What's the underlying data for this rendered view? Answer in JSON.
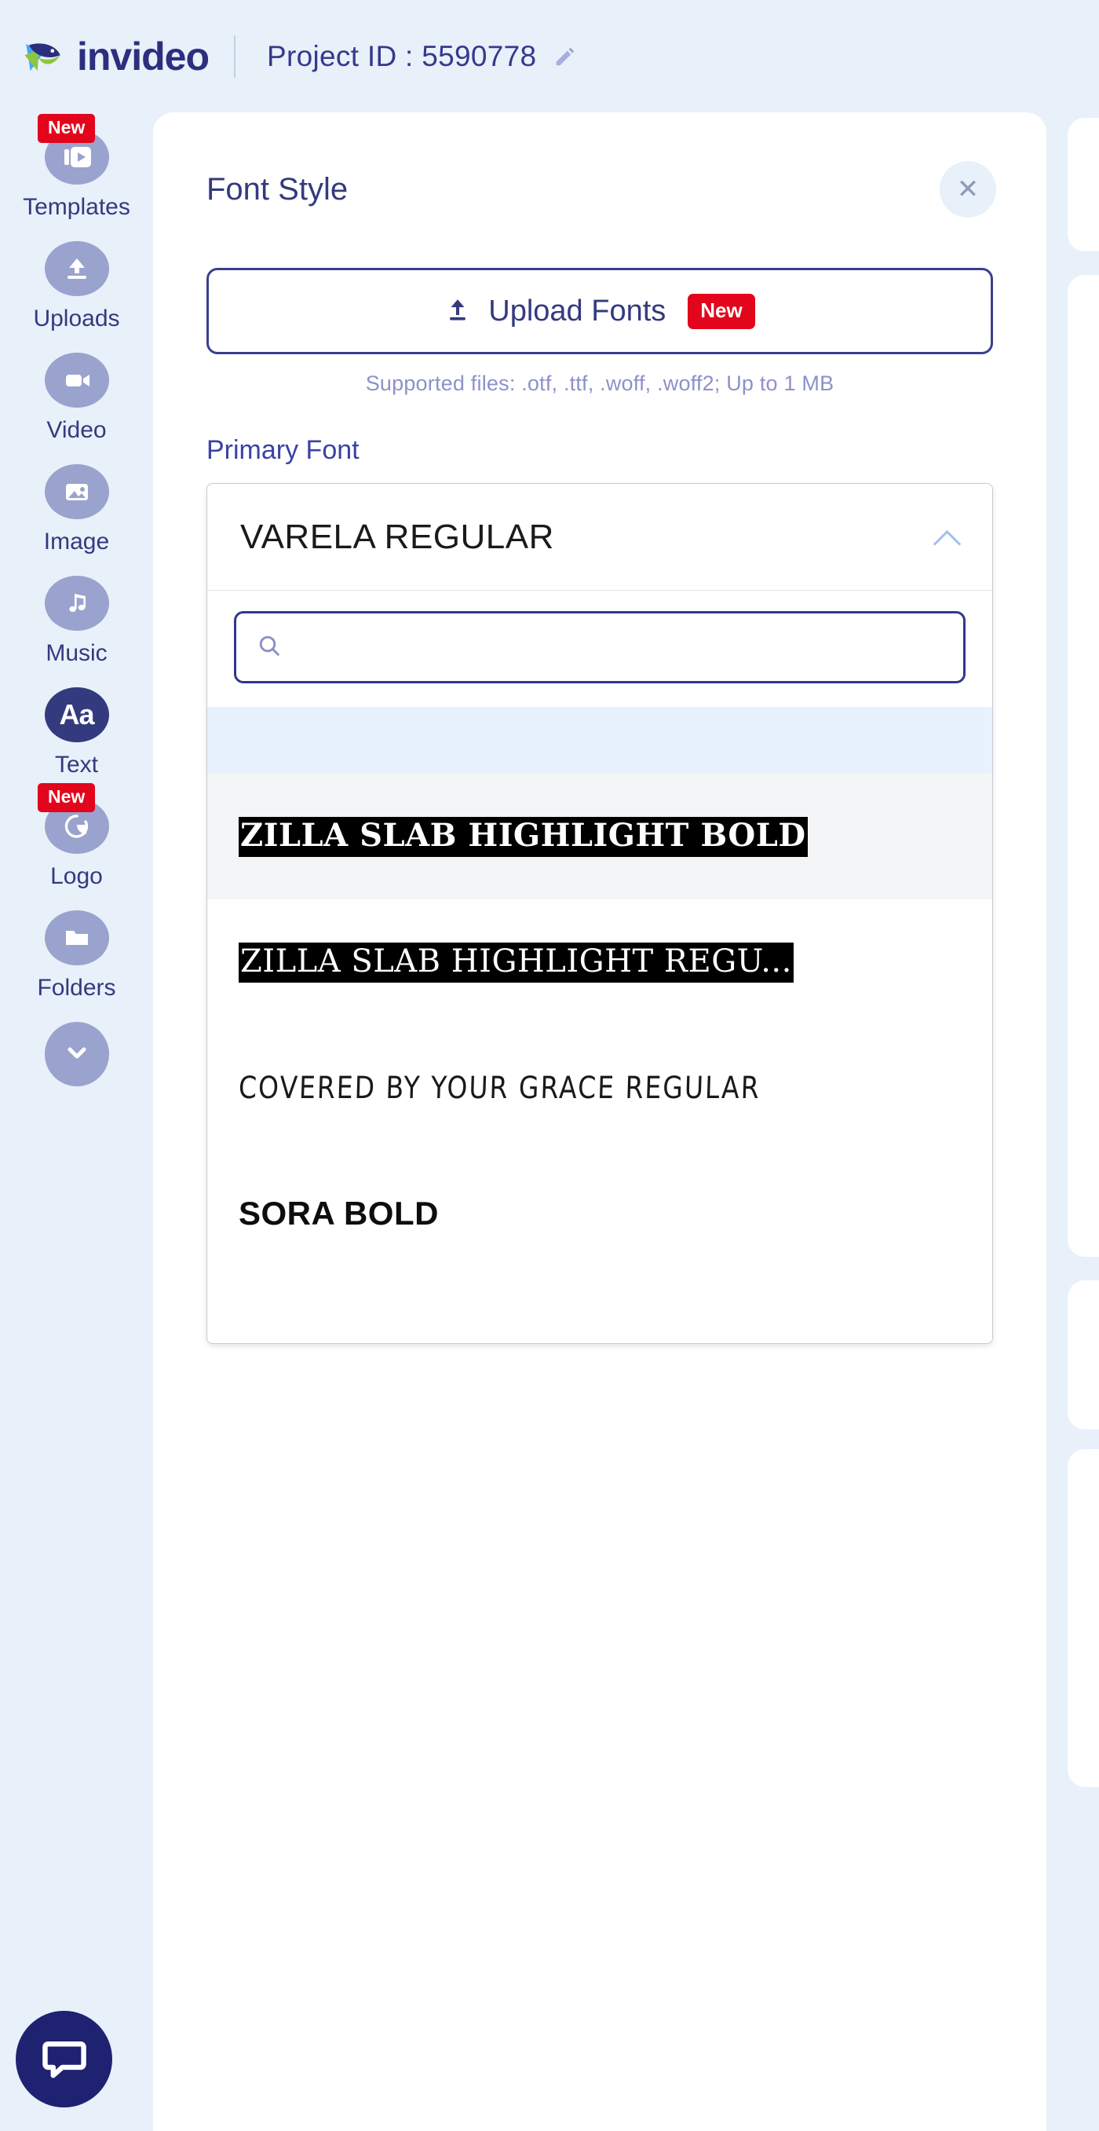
{
  "header": {
    "brand_name": "invideo",
    "brand_mark_icon": "invideo-logo-icon",
    "project_id_label": "Project ID : 5590778",
    "edit_icon": "pencil-icon"
  },
  "sidebar": {
    "items": [
      {
        "label": "Templates",
        "icon": "video-template-icon",
        "badge": "New",
        "active": false
      },
      {
        "label": "Uploads",
        "icon": "upload-icon",
        "badge": "",
        "active": false
      },
      {
        "label": "Video",
        "icon": "video-camera-icon",
        "badge": "",
        "active": false
      },
      {
        "label": "Image",
        "icon": "image-icon",
        "badge": "",
        "active": false
      },
      {
        "label": "Music",
        "icon": "music-note-icon",
        "badge": "",
        "active": false
      },
      {
        "label": "Text",
        "icon": "text-aa-icon",
        "badge": "",
        "active": true
      },
      {
        "label": "Logo",
        "icon": "logo-icon",
        "badge": "New",
        "active": false
      },
      {
        "label": "Folders",
        "icon": "folder-icon",
        "badge": "",
        "active": false
      }
    ],
    "collapse_icon": "chevron-down-icon",
    "chat_icon": "chat-bubble-icon"
  },
  "panel": {
    "title": "Font Style",
    "close_icon": "close-icon",
    "upload": {
      "icon": "upload-arrow-icon",
      "label": "Upload Fonts",
      "badge": "New",
      "supported_text": "Supported files: .otf, .ttf, .woff, .woff2; Up to 1 MB"
    },
    "primary_font": {
      "section_label": "Primary Font",
      "selected": "VARELA REGULAR",
      "chevron_icon": "chevron-up-icon",
      "search": {
        "icon": "search-icon",
        "value": "",
        "placeholder": ""
      },
      "options": [
        {
          "name": "ZILLA SLAB HIGHLIGHT BOLD",
          "style": "zilla-bold"
        },
        {
          "name": "ZILLA SLAB HIGHLIGHT REGU...",
          "style": "zilla-regular"
        },
        {
          "name": "COVERED BY YOUR GRACE REGULAR",
          "style": "grace"
        },
        {
          "name": "SORA BOLD",
          "style": "sora-bold"
        }
      ]
    }
  },
  "colors": {
    "app_background": "#e8f0fa",
    "brand_navy": "#2c2f7e",
    "accent_red": "#e3051b",
    "sidebar_icon": "#9aa3cd",
    "active_icon": "#343a7e",
    "panel_white": "#ffffff",
    "highlight_row": "#e8f2fc"
  }
}
